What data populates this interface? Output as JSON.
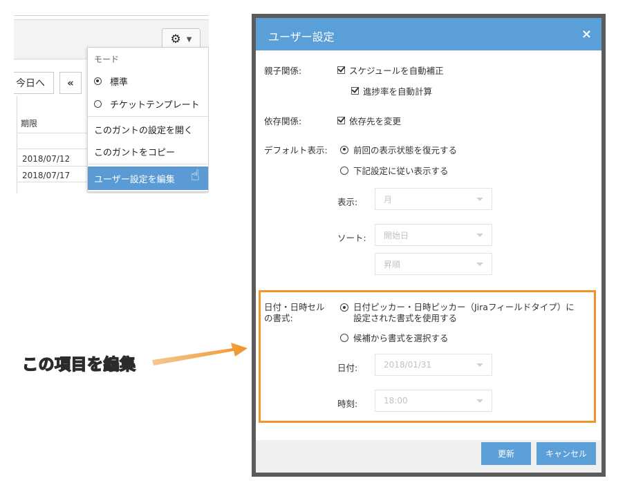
{
  "gantt": {
    "today_label": "今日へ",
    "prev_label": "«",
    "column_deadline": "期限",
    "dates": [
      "2018/07/12",
      "2018/07/17"
    ]
  },
  "menu": {
    "mode_header": "モード",
    "mode_standard": "標準",
    "mode_ticket_template": "チケットテンプレート",
    "open_settings": "このガントの設定を開く",
    "copy_gantt": "このガントをコピー",
    "edit_user_settings": "ユーザー設定を編集"
  },
  "dialog": {
    "title": "ユーザー設定",
    "close_icon": "×",
    "parent_child_label": "親子関係:",
    "auto_adjust_schedule": "スケジュールを自動補正",
    "auto_calc_progress": "進捗率を自動計算",
    "dependency_label": "依存関係:",
    "change_dependency": "依存先を変更",
    "default_display_label": "デフォルト表示:",
    "restore_previous": "前回の表示状態を復元する",
    "use_settings_below": "下記設定に従い表示する",
    "display_label": "表示:",
    "display_value": "月",
    "sort_label": "ソート:",
    "sort_value": "開始日",
    "order_value": "昇順",
    "datetime_format_label_line1": "日付・日時セル",
    "datetime_format_label_line2": "の書式:",
    "use_picker_format_line1": "日付ピッカー・日時ピッカー（Jiraフィールドタイプ）に",
    "use_picker_format_line2": "設定された書式を使用する",
    "choose_format": "候補から書式を選択する",
    "date_label": "日付:",
    "date_value": "2018/01/31",
    "time_label": "時刻:",
    "time_value": "18:00",
    "update_button": "更新",
    "cancel_button": "キャンセル"
  },
  "annotation": {
    "text": "この項目を編集"
  },
  "colors": {
    "accent_blue": "#5b9fd9",
    "highlight_orange": "#f0952a"
  }
}
